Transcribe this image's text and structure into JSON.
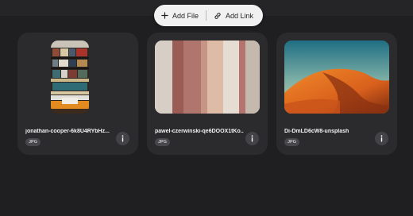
{
  "toolbar": {
    "add_file": "Add File",
    "add_link": "Add Link"
  },
  "files": [
    {
      "name": "jonathan-cooper-6k8U4RYbHz...",
      "type": "JPG"
    },
    {
      "name": "pawel-czerwinski-qe6DOOX1tKo...",
      "type": "JPG"
    },
    {
      "name": "Di-DmLD6cW8-unsplash",
      "type": "JPG"
    }
  ],
  "colors": {
    "background": "#1f1f21",
    "card": "#2b2b2e",
    "toolbar": "#f1f1f1"
  },
  "icons": {
    "add_file": "plus-icon",
    "add_link": "link-icon",
    "info": "info-icon"
  }
}
